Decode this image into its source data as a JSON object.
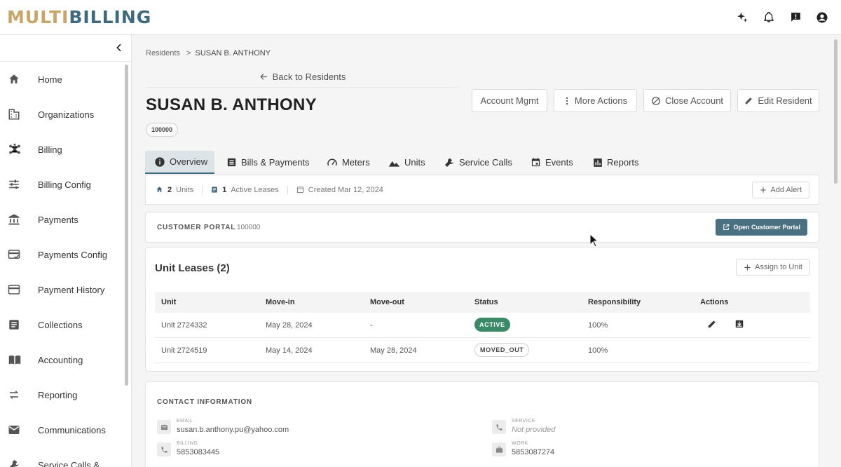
{
  "brand": {
    "part1": "MULTI",
    "part2": "BILLING"
  },
  "top_icons": [
    "sparkle-icon",
    "bell-icon",
    "feedback-icon",
    "account-icon"
  ],
  "sidebar": {
    "items": [
      {
        "label": "Home",
        "icon": "home-icon"
      },
      {
        "label": "Organizations",
        "icon": "organizations-icon"
      },
      {
        "label": "Billing",
        "icon": "billing-icon"
      },
      {
        "label": "Billing Config",
        "icon": "sliders-icon"
      },
      {
        "label": "Payments",
        "icon": "bank-icon"
      },
      {
        "label": "Payments Config",
        "icon": "payments-config-icon"
      },
      {
        "label": "Payment History",
        "icon": "credit-card-icon"
      },
      {
        "label": "Collections",
        "icon": "collections-icon"
      },
      {
        "label": "Accounting",
        "icon": "book-icon"
      },
      {
        "label": "Reporting",
        "icon": "swap-icon"
      },
      {
        "label": "Communications",
        "icon": "mail-icon"
      },
      {
        "label": "Service Calls &",
        "icon": "wrench-icon"
      }
    ]
  },
  "breadcrumb": {
    "root": "Residents",
    "separator": ">",
    "current": "SUSAN B. ANTHONY"
  },
  "back_link": "Back to Residents",
  "resident": {
    "name": "SUSAN B. ANTHONY",
    "id": "100000"
  },
  "header_buttons": {
    "account_mgmt": "Account Mgmt",
    "more_actions": "More Actions",
    "close_account": "Close Account",
    "edit_resident": "Edit Resident"
  },
  "tabs": [
    {
      "label": "Overview",
      "active": true
    },
    {
      "label": "Bills & Payments"
    },
    {
      "label": "Meters"
    },
    {
      "label": "Units"
    },
    {
      "label": "Service Calls"
    },
    {
      "label": "Events"
    },
    {
      "label": "Reports"
    }
  ],
  "summary": {
    "units_count": "2",
    "units_label": "Units",
    "leases_count": "1",
    "leases_label": "Active Leases",
    "created": "Created Mar 12, 2024",
    "add_alert": "Add Alert"
  },
  "portal": {
    "label": "CUSTOMER PORTAL",
    "value": "100000",
    "button": "Open Customer Portal"
  },
  "leases": {
    "title": "Unit Leases (2)",
    "assign_button": "Assign to Unit",
    "columns": [
      "Unit",
      "Move-in",
      "Move-out",
      "Status",
      "Responsibility",
      "Actions"
    ],
    "rows": [
      {
        "unit": "Unit 2724332",
        "move_in": "May 28, 2024",
        "move_out": "-",
        "status": "ACTIVE",
        "responsibility": "100%"
      },
      {
        "unit": "Unit 2724519",
        "move_in": "May 14, 2024",
        "move_out": "May 28, 2024",
        "status": "MOVED_OUT",
        "responsibility": "100%"
      }
    ]
  },
  "contact": {
    "title": "CONTACT INFORMATION",
    "email": {
      "label": "EMAIL",
      "value": "susan.b.anthony.pu@yahoo.com"
    },
    "service": {
      "label": "SERVICE",
      "value": "Not provided"
    },
    "billing": {
      "label": "BILLING",
      "value": "5853083445"
    },
    "work": {
      "label": "WORK",
      "value": "5853087274"
    }
  },
  "colors": {
    "brand_gold": "#c9a56a",
    "brand_blue": "#3e6a80",
    "active_green": "#3a8a67",
    "primary_button": "#4a7182"
  }
}
